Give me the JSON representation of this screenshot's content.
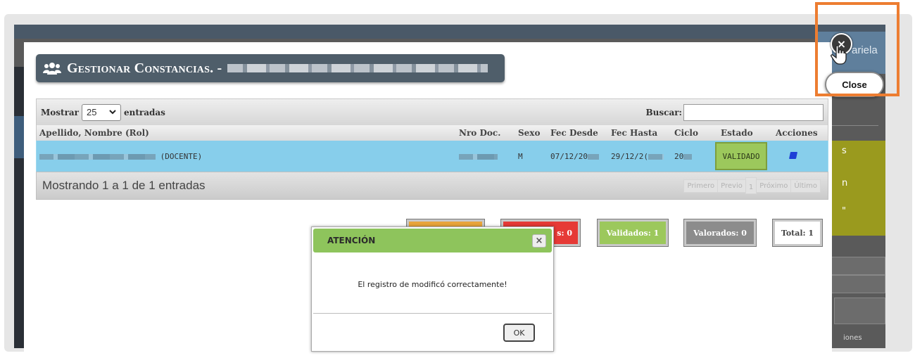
{
  "window": {
    "background_user": "ariela"
  },
  "background_panel": {
    "yellow_lines": [
      "s",
      "n",
      "\""
    ],
    "actions_label": "iones"
  },
  "modal": {
    "title": "Gestionar Constancias. -",
    "title_icon": "users-icon"
  },
  "table": {
    "length_prefix": "Mostrar",
    "length_value": "25",
    "length_suffix": "entradas",
    "search_label": "Buscar:",
    "search_value": "",
    "columns": [
      "Apellido, Nombre (Rol)",
      "Nro Doc.",
      "Sexo",
      "Fec Desde",
      "Fec Hasta",
      "Ciclo",
      "Estado",
      "Acciones"
    ],
    "rows": [
      {
        "name_suffix": "(DOCENTE)",
        "sexo": "M",
        "fec_desde": "07/12/20",
        "fec_hasta": "29/12/2(",
        "ciclo": "20",
        "estado": "VALIDADO",
        "accion_icon": "book-icon"
      }
    ],
    "info": "Mostrando 1 a 1 de 1 entradas",
    "pager": [
      "Primero",
      "Previo",
      "1",
      "Próximo",
      "Último"
    ]
  },
  "stats": {
    "red_label": "s: 0",
    "validados": "Validados: 1",
    "valorados": "Valorados: 0",
    "total": "Total: 1"
  },
  "dialog": {
    "title": "ATENCIÓN",
    "message": "El registro de modificó correctamente!",
    "ok": "OK",
    "close_glyph": "×"
  },
  "close_control": {
    "glyph": "×",
    "tooltip": "Close",
    "highlight_color": "#ed7d31"
  }
}
